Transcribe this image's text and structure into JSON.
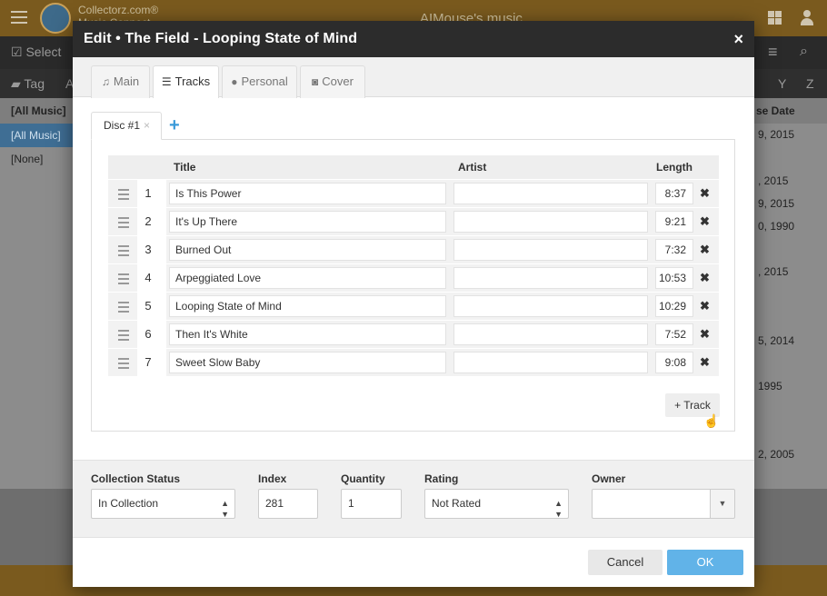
{
  "background": {
    "brand": "Collectorz.com®",
    "brand_sub": "Music Connect",
    "title": "AIMouse's music",
    "toolbar_select": "Select",
    "toolbar_tag": "Tag",
    "toolbar_letter_a": "A",
    "toolbar_letter_y": "Y",
    "toolbar_letter_z": "Z",
    "list_header_left": "[All Music]",
    "list_header_right": "se Date",
    "list_items": [
      "[All Music]",
      "[None]"
    ],
    "dates": [
      "9, 2015",
      ", 2015",
      "9, 2015",
      "0, 1990",
      ", 2015",
      "5, 2014",
      "1995",
      "2, 2005"
    ]
  },
  "modal": {
    "title": "Edit • The Field - Looping State of Mind",
    "close": "×",
    "tabs": [
      {
        "icon": "music-icon",
        "glyph": "♫",
        "label": "Main"
      },
      {
        "icon": "list-icon",
        "glyph": "☰",
        "label": "Tracks"
      },
      {
        "icon": "user-icon",
        "glyph": "●",
        "label": "Personal"
      },
      {
        "icon": "camera-icon",
        "glyph": "◙",
        "label": "Cover"
      }
    ],
    "active_tab": "Tracks",
    "disc_tab": "Disc #1",
    "disc_remove": "×",
    "disc_add": "+",
    "columns": {
      "title": "Title",
      "artist": "Artist",
      "length": "Length"
    },
    "tracks": [
      {
        "num": "1",
        "title": "Is This Power",
        "artist": "",
        "length": "8:37"
      },
      {
        "num": "2",
        "title": "It's Up There",
        "artist": "",
        "length": "9:21"
      },
      {
        "num": "3",
        "title": "Burned Out",
        "artist": "",
        "length": "7:32"
      },
      {
        "num": "4",
        "title": "Arpeggiated Love",
        "artist": "",
        "length": "10:53"
      },
      {
        "num": "5",
        "title": "Looping State of Mind",
        "artist": "",
        "length": "10:29"
      },
      {
        "num": "6",
        "title": "Then It's White",
        "artist": "",
        "length": "7:52"
      },
      {
        "num": "7",
        "title": "Sweet Slow Baby",
        "artist": "",
        "length": "9:08"
      }
    ],
    "add_track": "+ Track",
    "fields": {
      "collection_status_label": "Collection Status",
      "collection_status_value": "In Collection",
      "index_label": "Index",
      "index_value": "281",
      "quantity_label": "Quantity",
      "quantity_value": "1",
      "rating_label": "Rating",
      "rating_value": "Not Rated",
      "owner_label": "Owner",
      "owner_value": ""
    },
    "cancel": "Cancel",
    "ok": "OK"
  },
  "colors": {
    "accent": "#61b3e8",
    "header": "#2c2c2c",
    "topbar": "#7a5a1e"
  }
}
